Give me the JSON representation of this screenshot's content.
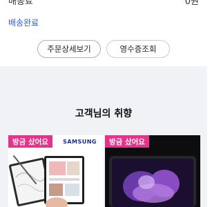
{
  "order": {
    "top_left": "배송료",
    "top_right": "0원",
    "status": "배송완료",
    "detail_button": "주문상세보기",
    "receipt_button": "영수증조회"
  },
  "recommend": {
    "title": "고객님의 취향",
    "products": [
      {
        "badge": "방금 샀어요",
        "brand": "SAMSUNG",
        "badge_color": "#e3348a"
      },
      {
        "badge": "방금 샀어요",
        "badge_color": "#e3348a"
      }
    ]
  },
  "colors": {
    "accent_blue": "#2a5bd7",
    "band_bg": "#f1f2f6"
  }
}
